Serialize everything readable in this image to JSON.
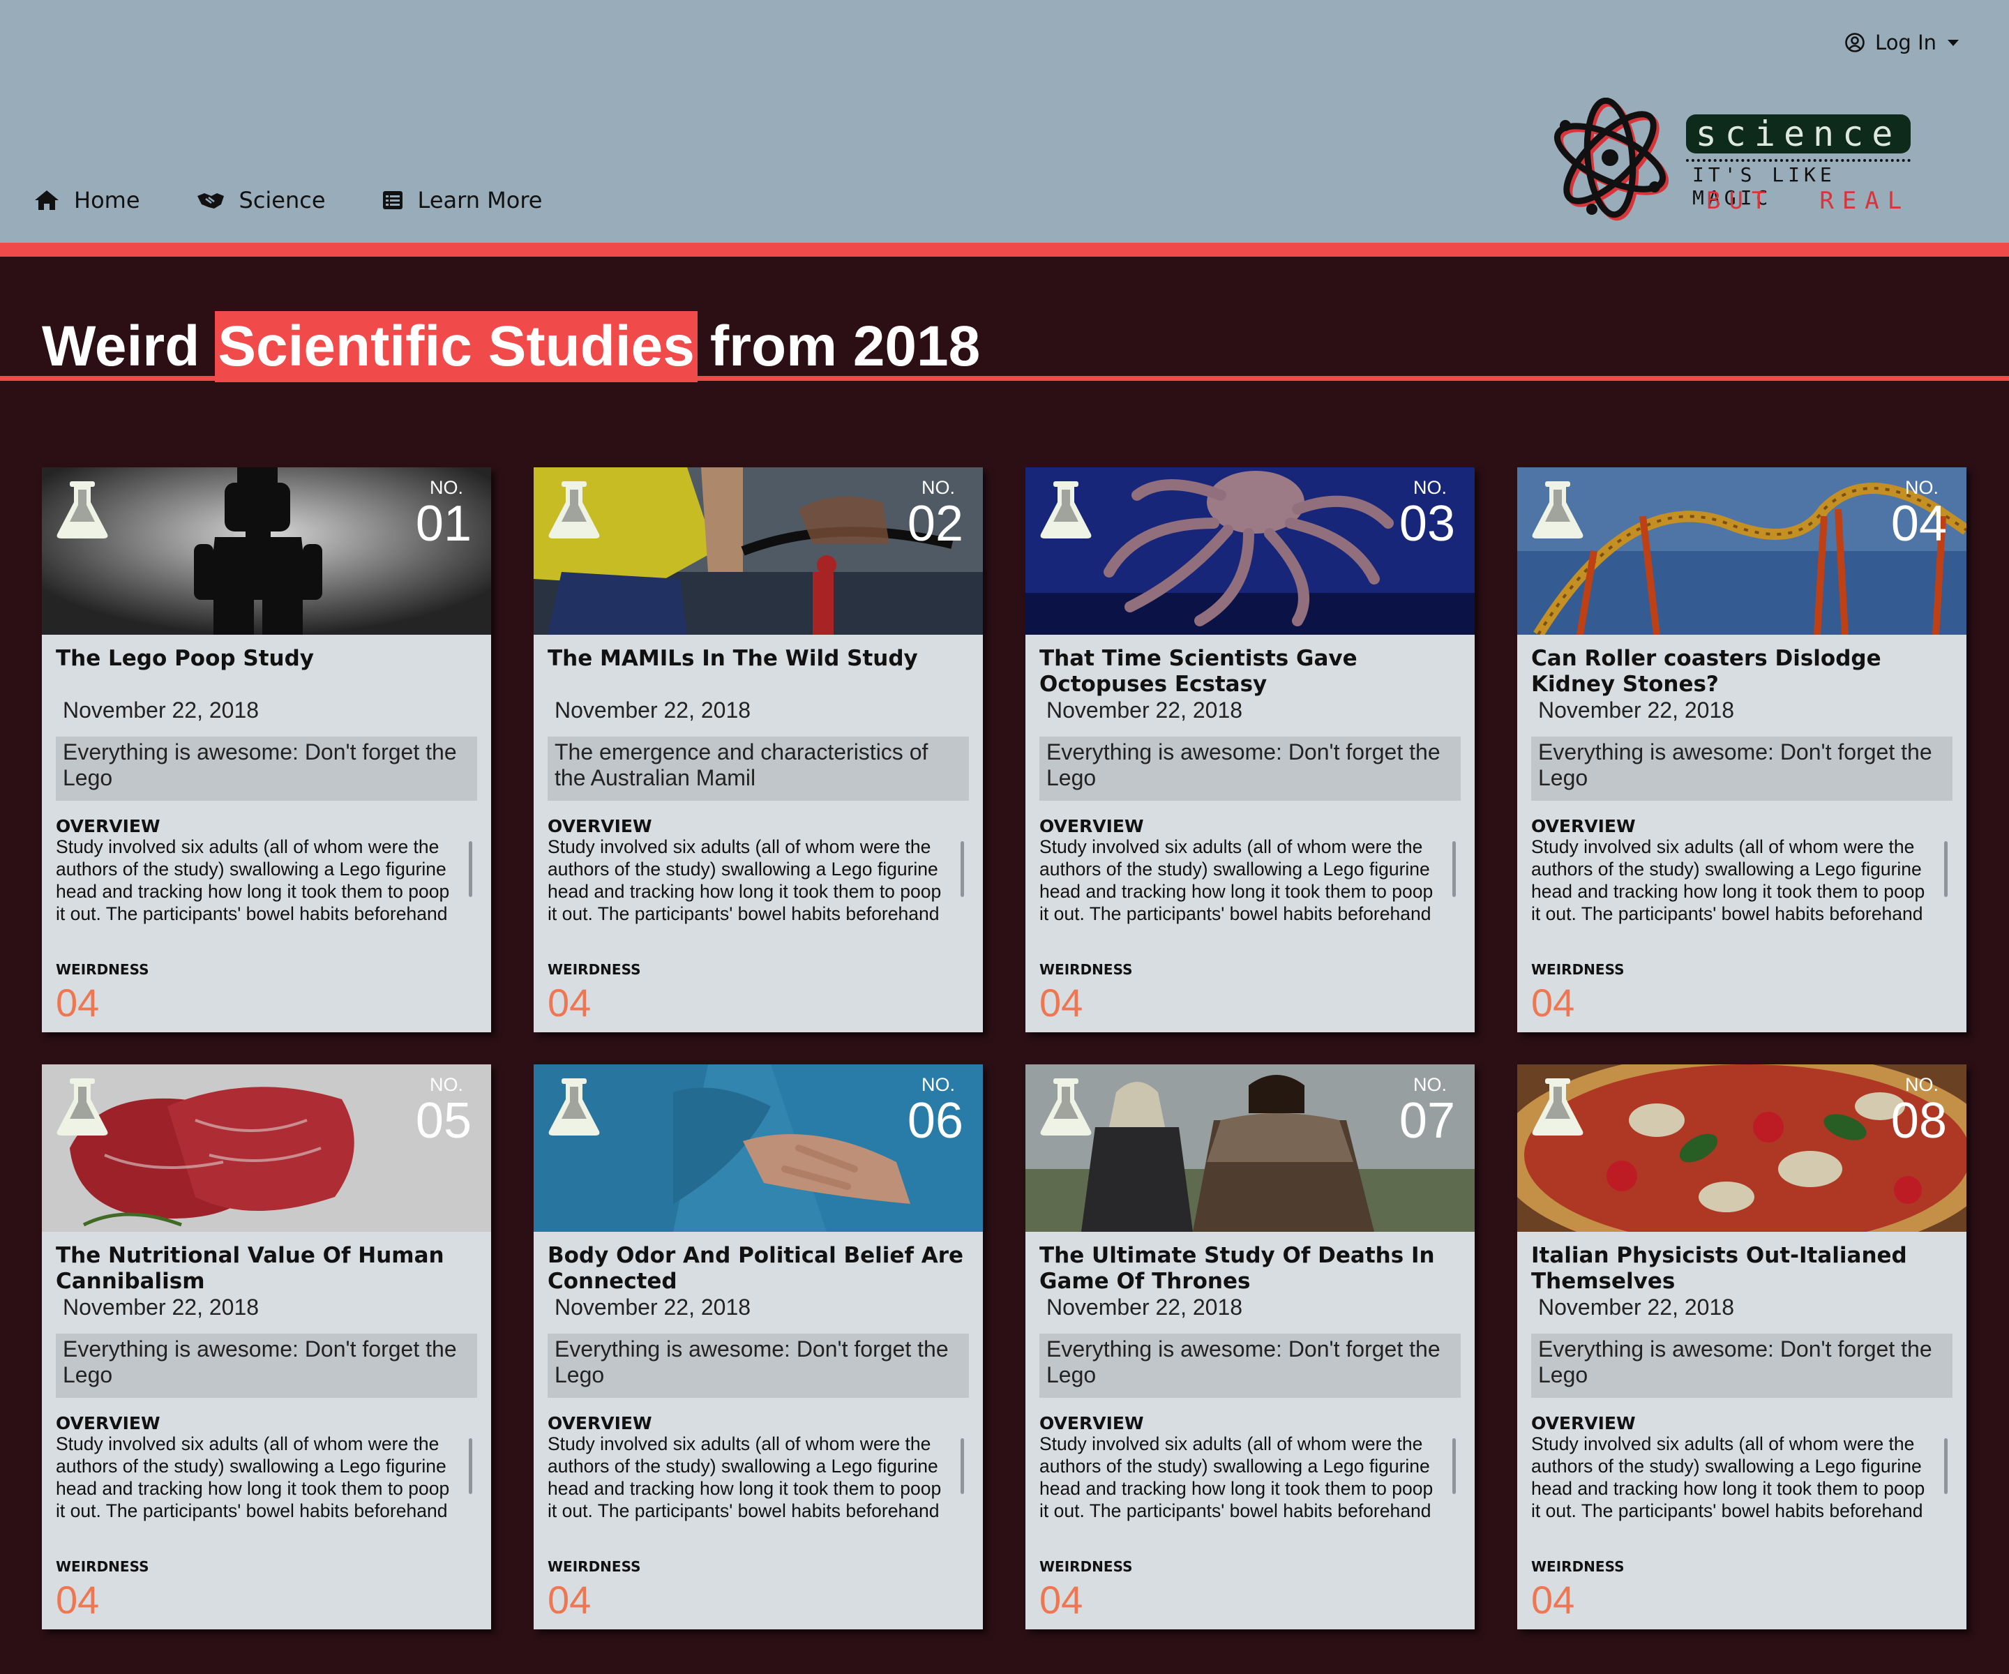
{
  "header": {
    "login_label": "Log In",
    "nav": [
      {
        "label": "Home",
        "icon": "home-icon"
      },
      {
        "label": "Science",
        "icon": "handshake-icon"
      },
      {
        "label": "Learn More",
        "icon": "list-icon"
      }
    ],
    "logo": {
      "word": "science",
      "tagline": "IT'S LIKE MAGIC",
      "tagline2": "BUT  REAL"
    }
  },
  "page": {
    "title_pre": "Weird",
    "title_highlight": "Scientific Studies",
    "title_post": "from 2018"
  },
  "labels": {
    "no": "NO.",
    "overview": "OVERVIEW",
    "weirdness": "WEIRDNESS"
  },
  "cards": [
    {
      "no": "01",
      "title": "The Lego Poop Study",
      "date": "November 22, 2018",
      "summary": "Everything is awesome: Don't forget the Lego",
      "overview": "Study involved six adults (all of whom were the authors of the study) swallowing a Lego figurine head and tracking how long it took them to poop it out. The participants' bowel habits beforehand",
      "weirdness": "04",
      "image": "lego"
    },
    {
      "no": "02",
      "title": "The MAMILs In The Wild Study",
      "date": "November 22, 2018",
      "summary": "The emergence and characteristics of the Australian Mamil",
      "overview": "Study involved six adults (all of whom were the authors of the study) swallowing a Lego figurine head and tracking how long it took them to poop it out. The participants' bowel habits beforehand",
      "weirdness": "04",
      "image": "cyclist"
    },
    {
      "no": "03",
      "title": "That Time Scientists Gave Octopuses Ecstasy",
      "date": "November 22, 2018",
      "summary": "Everything is awesome: Don't forget the Lego",
      "overview": "Study involved six adults (all of whom were the authors of the study) swallowing a Lego figurine head and tracking how long it took them to poop it out. The participants' bowel habits beforehand",
      "weirdness": "04",
      "image": "octopus"
    },
    {
      "no": "04",
      "title": "Can Roller coasters Dislodge Kidney Stones?",
      "date": "November 22, 2018",
      "summary": "Everything is awesome: Don't forget the Lego",
      "overview": "Study involved six adults (all of whom were the authors of the study) swallowing a Lego figurine head and tracking how long it took them to poop it out. The participants' bowel habits beforehand",
      "weirdness": "04",
      "image": "coaster"
    },
    {
      "no": "05",
      "title": "The Nutritional Value Of Human Cannibalism",
      "date": "November 22, 2018",
      "summary": "Everything is awesome: Don't forget the Lego",
      "overview": "Study involved six adults (all of whom were the authors of the study) swallowing a Lego figurine head and tracking how long it took them to poop it out. The participants' bowel habits beforehand",
      "weirdness": "04",
      "image": "meat"
    },
    {
      "no": "06",
      "title": "Body Odor And Political Belief Are Connected",
      "date": "November 22, 2018",
      "summary": "Everything is awesome: Don't forget the Lego",
      "overview": "Study involved six adults (all of whom were the authors of the study) swallowing a Lego figurine head and tracking how long it took them to poop it out. The participants' bowel habits beforehand",
      "weirdness": "04",
      "image": "shirt"
    },
    {
      "no": "07",
      "title": "The Ultimate Study Of Deaths In Game Of Thrones",
      "date": "November 22, 2018",
      "summary": "Everything is awesome: Don't forget the Lego",
      "overview": "Study involved six adults (all of whom were the authors of the study) swallowing a Lego figurine head and tracking how long it took them to poop it out. The participants' bowel habits beforehand",
      "weirdness": "04",
      "image": "thrones"
    },
    {
      "no": "08",
      "title": "Italian Physicists Out-Italianed Themselves",
      "date": "November 22, 2018",
      "summary": "Everything is awesome: Don't forget the Lego",
      "overview": "Study involved six adults (all of whom were the authors of the study) swallowing a Lego figurine head and tracking how long it took them to poop it out. The participants' bowel habits beforehand",
      "weirdness": "04",
      "image": "pizza"
    }
  ],
  "colors": {
    "header_bg": "#98acb9",
    "accent": "#f04a4a",
    "page_bg": "#2b0f15",
    "card_bg": "#d8dde1",
    "weirdness": "#ee7650"
  }
}
